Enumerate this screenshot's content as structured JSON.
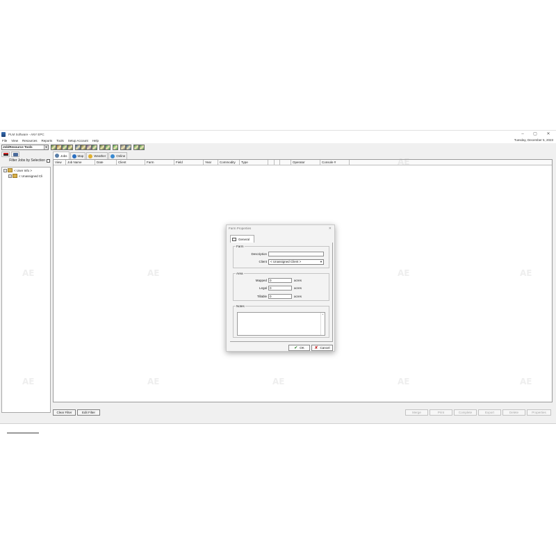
{
  "window": {
    "title": "PLM Software - ANY EPC",
    "min": "–",
    "max": "▢",
    "close": "✕"
  },
  "menu": [
    "File",
    "View",
    "Resources",
    "Reports",
    "Tools",
    "Setup Account",
    "Help"
  ],
  "date": "Tuesday, December 5, 2023",
  "toolbar": {
    "tool_select": "Job/Resource Tools",
    "button_colors": [
      "#3e7a2c",
      "#9a6b1f",
      "#2d7d3a",
      "#546a1e",
      "#2b4e8c",
      "#6b6b2b",
      "#6a4a8a",
      "#2f7f47",
      "#4b6a2a",
      "#2a8a3a",
      "#2c5f8f",
      "#6f6f6f",
      "#36a03a",
      "#3a8a3a"
    ]
  },
  "left_panel": {
    "filter_label": "Filter Jobs by Selection",
    "tree": [
      {
        "toggle": "−",
        "label": "< User Info >"
      },
      {
        "toggle": "+",
        "label": "< Unassigned Cli"
      }
    ]
  },
  "main_tabs": [
    {
      "label": "Jobs",
      "color": "#5a7fa8"
    },
    {
      "label": "Map",
      "color": "#2a6fc0"
    },
    {
      "label": "Weather",
      "color": "#e0b030"
    },
    {
      "label": "Online",
      "color": "#3a8ad0"
    }
  ],
  "columns": [
    "View",
    "Job Name",
    "Date",
    "Client",
    "Farm",
    "Field",
    "Year",
    "Commodity",
    "Type",
    "",
    "",
    "",
    "Operator",
    "Console #",
    ""
  ],
  "bottom_buttons": {
    "clear_filter": "Clear Filter",
    "edit_filter": "Edit Filter",
    "right": [
      "Merge",
      "Print",
      "Complete",
      "Export",
      "Delete",
      "Properties"
    ]
  },
  "dialog": {
    "title": "Farm Properties",
    "close": "✕",
    "tab": "General",
    "farm_group": "Farm",
    "description_label": "Description",
    "description_value": "",
    "client_label": "Client",
    "client_value": "< Unassigned Client >",
    "area_group": "Area",
    "mapped_label": "Mapped",
    "mapped_value": "0",
    "legal_label": "Legal",
    "legal_value": "0",
    "tillable_label": "Tillable",
    "tillable_value": "0",
    "unit": "acres",
    "notes_group": "Notes",
    "notes_value": "",
    "ok": "OK",
    "cancel": "Cancel"
  },
  "watermark": "AE"
}
